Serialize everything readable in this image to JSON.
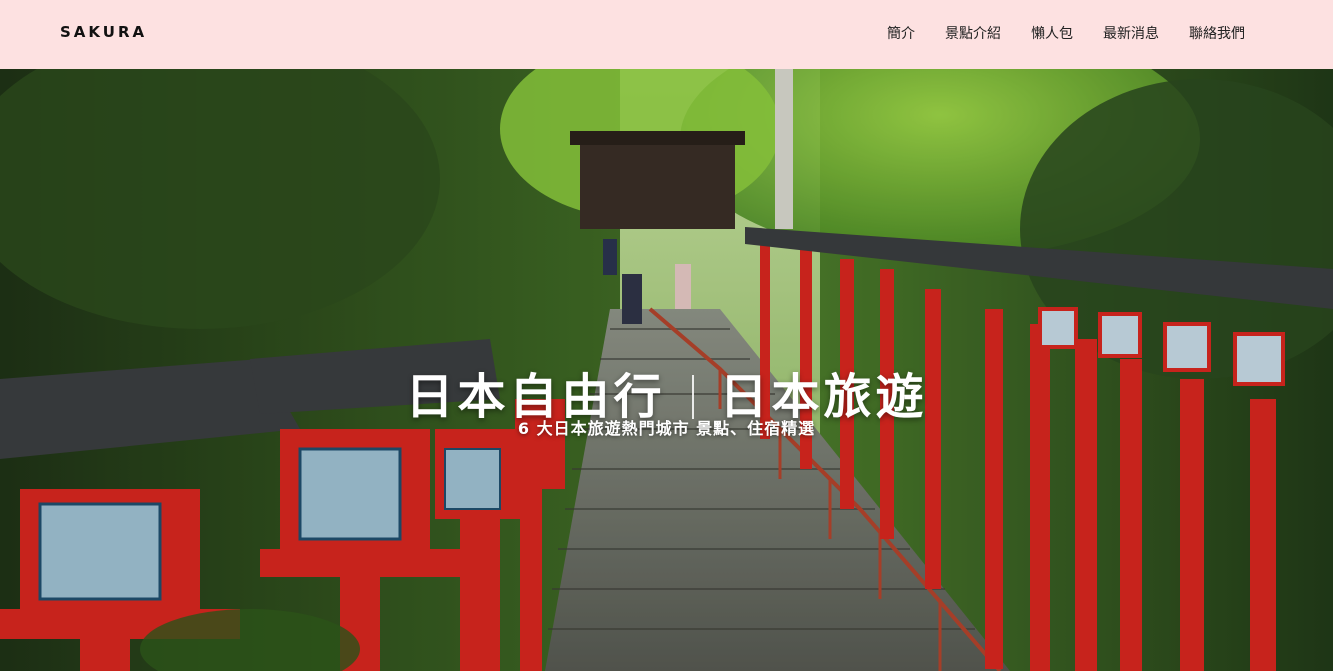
{
  "brand": {
    "name": "SAKURA"
  },
  "nav": {
    "items": [
      {
        "label": "簡介"
      },
      {
        "label": "景點介紹"
      },
      {
        "label": "懶人包"
      },
      {
        "label": "最新消息"
      },
      {
        "label": "聯絡我們"
      }
    ]
  },
  "hero": {
    "title_left": "日本自由行",
    "title_right": "日本旅遊",
    "subtitle": "6 大日本旅遊熱門城市 景點、住宿精選",
    "background_image": "photo-stone-stairway-with-red-lanterns-kibune-shrine"
  },
  "colors": {
    "navbar_background": "#fde1e1",
    "text_dark": "#111111",
    "hero_text": "#ffffff",
    "lantern_red": "#d8261f"
  }
}
